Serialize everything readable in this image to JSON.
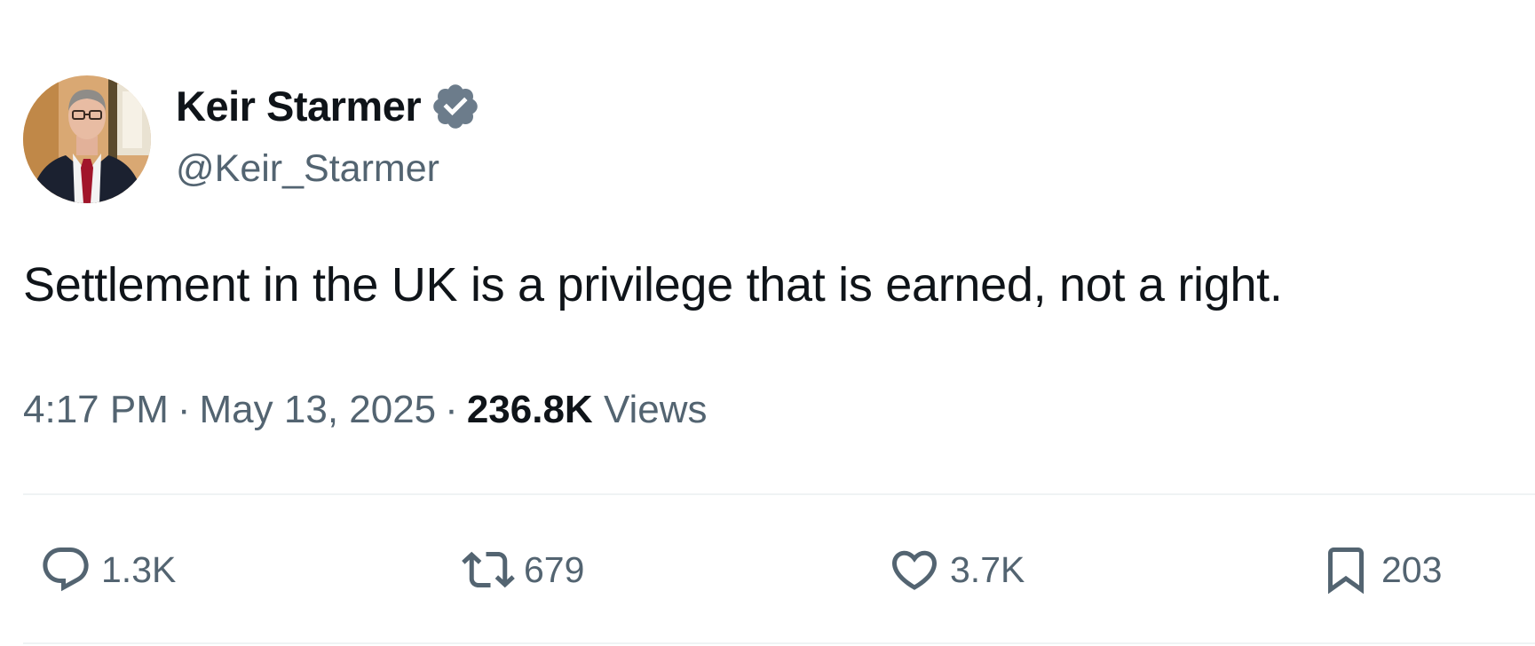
{
  "author": {
    "display_name": "Keir Starmer",
    "handle": "@Keir_Starmer",
    "verified": true,
    "verified_badge_color": "#1d9bf0"
  },
  "tweet": {
    "text": "Settlement in the UK is a privilege that is earned, not a right.",
    "time": "4:17 PM",
    "date": "May 13, 2025",
    "separator": "·",
    "views_count": "236.8K",
    "views_label": "Views"
  },
  "actions": {
    "reply": {
      "icon": "reply-icon",
      "count": "1.3K"
    },
    "retweet": {
      "icon": "retweet-icon",
      "count": "679"
    },
    "like": {
      "icon": "heart-icon",
      "count": "3.7K"
    },
    "bookmark": {
      "icon": "bookmark-icon",
      "count": "203"
    }
  },
  "colors": {
    "text_primary": "#0f1419",
    "text_secondary": "#536471",
    "divider": "#eff3f4"
  }
}
